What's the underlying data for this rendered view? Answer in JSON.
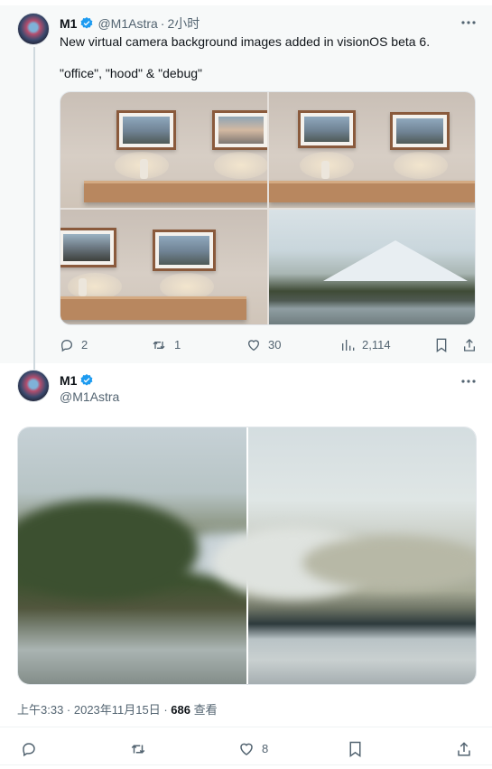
{
  "tweets": [
    {
      "author": {
        "name": "M1",
        "handle": "@M1Astra",
        "time": "2小时"
      },
      "text_line1": "New virtual camera background images added in visionOS beta 6.",
      "text_line2": "\"office\", \"hood\" & \"debug\"",
      "images": [
        "office-scene-1",
        "office-scene-2",
        "office-scene-3",
        "mountain-lake"
      ],
      "stats": {
        "replies": "2",
        "retweets": "1",
        "likes": "30",
        "views": "2,114"
      }
    },
    {
      "author": {
        "name": "M1",
        "handle": "@M1Astra"
      },
      "images": [
        "blurred-forest-lake",
        "blurred-mountain-lake"
      ],
      "meta": {
        "time_date": "上午3:33 · 2023年11月15日 · ",
        "views": "686",
        "views_label": " 查看"
      },
      "stats": {
        "likes": "8"
      }
    }
  ],
  "colors": {
    "verified": "#1d9bf0",
    "text": "#0f1419",
    "secondary": "#536471"
  },
  "icons": [
    "more-icon",
    "verified-icon",
    "reply-icon",
    "retweet-icon",
    "like-icon",
    "views-icon",
    "bookmark-icon",
    "share-icon"
  ]
}
